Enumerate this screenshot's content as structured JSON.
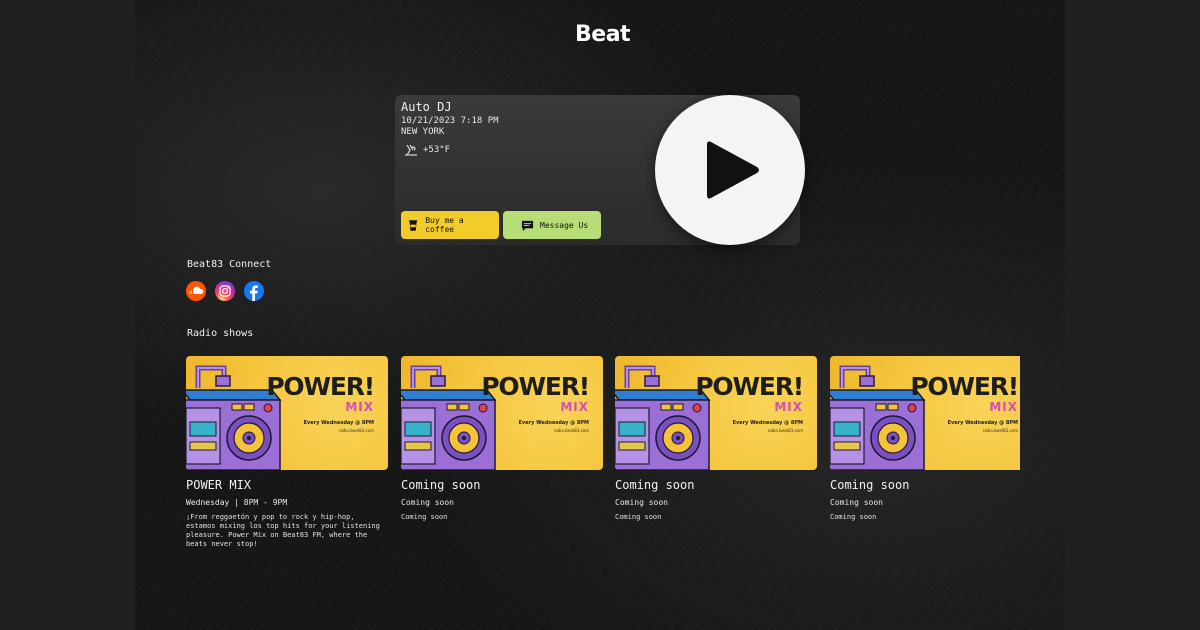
{
  "brand": {
    "logo": "Beat"
  },
  "player": {
    "title": "Auto DJ",
    "datetime": "10/21/2023 7:18 PM",
    "city": "NEW YORK",
    "weather": {
      "icon": "windy-weather-icon",
      "temp": "+53°F"
    },
    "coffee_button": "Buy me a coffee",
    "message_button": "Message Us",
    "play_icon": "play-icon"
  },
  "connect": {
    "title": "Beat83 Connect",
    "links": [
      {
        "name": "soundcloud-icon",
        "color": "#ff5500"
      },
      {
        "name": "instagram-icon",
        "color": "#d6249f"
      },
      {
        "name": "facebook-icon",
        "color": "#1877f2"
      }
    ]
  },
  "shows": {
    "title": "Radio shows",
    "cover": {
      "headline": "POWER!",
      "subheadline": "MIX",
      "schedule": "Every Wednesday @ 8PM",
      "site": "radio.beat83.com"
    },
    "items": [
      {
        "name": "POWER MIX",
        "time": "Wednesday | 8PM - 9PM",
        "desc": "¡From reggaetón y pop to rock y hip-hop, estamos mixing los top hits for your listening pleasure. Power Mix on Beat83 FM, where the beats never stop!"
      },
      {
        "name": "Coming soon",
        "time": "Coming soon",
        "desc": "Coming soon"
      },
      {
        "name": "Coming soon",
        "time": "Coming soon",
        "desc": "Coming soon"
      },
      {
        "name": "Coming soon",
        "time": "Coming soon",
        "desc": "Coming soon"
      }
    ]
  },
  "colors": {
    "coffee": "#f2cc2b",
    "message": "#b7de76",
    "cover_yellow": "#f4c33a",
    "mix_pink": "#d24fb6"
  }
}
